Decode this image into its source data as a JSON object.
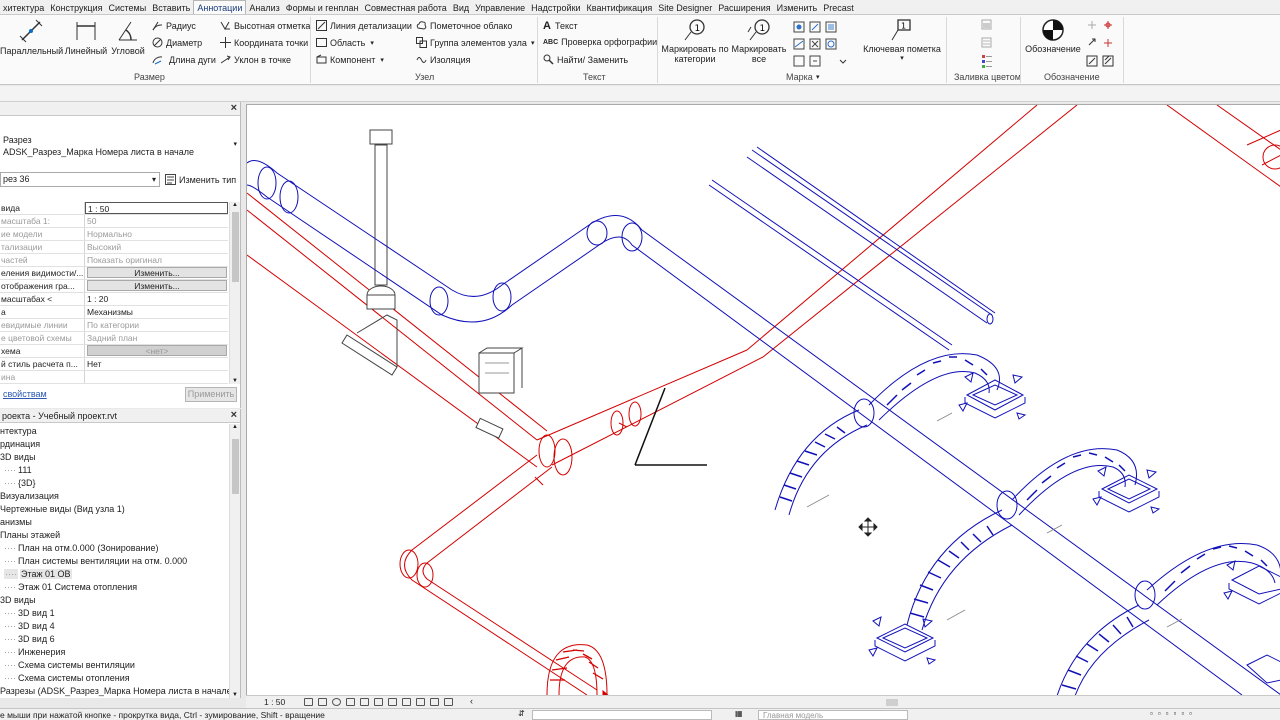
{
  "tabs": [
    {
      "label": "хитектура",
      "active": false
    },
    {
      "label": "Конструкция",
      "active": false
    },
    {
      "label": "Системы",
      "active": false
    },
    {
      "label": "Вставить",
      "active": false
    },
    {
      "label": "Аннотации",
      "active": true
    },
    {
      "label": "Анализ",
      "active": false
    },
    {
      "label": "Формы и генплан",
      "active": false
    },
    {
      "label": "Совместная работа",
      "active": false
    },
    {
      "label": "Вид",
      "active": false
    },
    {
      "label": "Управление",
      "active": false
    },
    {
      "label": "Надстройки",
      "active": false
    },
    {
      "label": "Квантификация",
      "active": false
    },
    {
      "label": "Site Designer",
      "active": false
    },
    {
      "label": "Расширения",
      "active": false
    },
    {
      "label": "Изменить",
      "active": false
    },
    {
      "label": "Precast",
      "active": false
    }
  ],
  "ribbon": {
    "dimension": {
      "parallel": "Параллельный",
      "linear": "Линейный",
      "angular": "Угловой",
      "radius": "Радиус",
      "diameter": "Диаметр",
      "arc_length": "Длина дуги",
      "spot_elevation": "Высотная отметка",
      "spot_coordinate": "Координата точки",
      "spot_slope": "Уклон  в точке",
      "panel": "Размер"
    },
    "detail": {
      "detail_line": "Линия детализации",
      "region": "Область",
      "component": "Компонент",
      "revision_cloud": "Пометочное облако",
      "detail_group": "Группа элементов узла",
      "insulation": "Изоляция",
      "panel": "Узел"
    },
    "text": {
      "text": "Текст",
      "spelling": "Проверка  орфографии",
      "find_replace": "Найти/ Заменить",
      "panel": "Текст"
    },
    "tag": {
      "by_category": "Маркировать по категории",
      "tag_all": "Маркировать все",
      "keynote": "Ключевая пометка",
      "panel": "Марка"
    },
    "color_fill": {
      "panel": "Заливка цветом"
    },
    "symbol": {
      "symbol": "Обозначение",
      "panel": "Обозначение"
    }
  },
  "properties": {
    "type_family": "Разрез",
    "type_name": "ADSK_Разрез_Марка Номера листа в начале",
    "selector": "рез 36",
    "edit_type": "Изменить тип",
    "rows": [
      {
        "k": "вида",
        "v": "1 : 50",
        "dim": false,
        "boxed": true
      },
      {
        "k": "масштаба   1:",
        "v": "50",
        "dim": true
      },
      {
        "k": "ие модели",
        "v": "Нормально",
        "dim": true
      },
      {
        "k": "тализации",
        "v": "Высокий",
        "dim": true
      },
      {
        "k": "частей",
        "v": "Показать оригинал",
        "dim": true
      },
      {
        "k": "еления видимости/...",
        "v": "Изменить...",
        "btn": true
      },
      {
        "k": "отображения гра...",
        "v": "Изменить...",
        "btn": true
      },
      {
        "k": "масштабах <",
        "v": "1 : 20",
        "dim": false
      },
      {
        "k": "а",
        "v": "Механизмы",
        "dim": false
      },
      {
        "k": "евидимые линии",
        "v": "По категории",
        "dim": true
      },
      {
        "k": "е цветовой схемы",
        "v": "Задний план",
        "dim": true
      },
      {
        "k": "хема",
        "v": "<нет>",
        "btn": true,
        "disabled": true
      },
      {
        "k": "й стиль расчета п...",
        "v": "Нет",
        "dim": false
      },
      {
        "k": "ина",
        "v": "",
        "dim": true
      }
    ],
    "link": "свойствам",
    "apply": "Применить"
  },
  "browser": {
    "title": "роекта - Учебный проект.rvt",
    "items": [
      {
        "label": "нтектура",
        "indent": 0
      },
      {
        "label": "рдинация",
        "indent": 0
      },
      {
        "label": "3D виды",
        "indent": 0
      },
      {
        "label": "111",
        "indent": 1,
        "dots": true
      },
      {
        "label": "{3D}",
        "indent": 1,
        "dots": true
      },
      {
        "label": "Визуализация",
        "indent": 0
      },
      {
        "label": "Чертежные виды (Вид узла 1)",
        "indent": 0
      },
      {
        "label": "анизмы",
        "indent": 0
      },
      {
        "label": "Планы этажей",
        "indent": 0
      },
      {
        "label": "План на отм.0.000 (Зонирование)",
        "indent": 1,
        "dots": true
      },
      {
        "label": "План системы вентиляции на отм. 0.000",
        "indent": 1,
        "dots": true
      },
      {
        "label": "Этаж 01 ОВ",
        "indent": 1,
        "dots": true,
        "selected": true
      },
      {
        "label": "Этаж 01 Система отопления",
        "indent": 1,
        "dots": true
      },
      {
        "label": "3D виды",
        "indent": 0
      },
      {
        "label": "3D вид 1",
        "indent": 1,
        "dots": true
      },
      {
        "label": "3D вид 4",
        "indent": 1,
        "dots": true
      },
      {
        "label": "3D вид 6",
        "indent": 1,
        "dots": true
      },
      {
        "label": "Инженерия",
        "indent": 1,
        "dots": true
      },
      {
        "label": "Схема системы вентиляции",
        "indent": 1,
        "dots": true
      },
      {
        "label": "Схема системы отопления",
        "indent": 1,
        "dots": true
      },
      {
        "label": "Разрезы (ADSK_Разрез_Марка Номера листа в начале)",
        "indent": 0
      }
    ]
  },
  "viewbar": {
    "scale": "1 : 50"
  },
  "status": {
    "message": "е мыши при нажатой кнопке - прокрутка вида, Ctrl - зумирование, Shift - вращение",
    "model": "Главная модель"
  },
  "colors": {
    "supply": "#d40000",
    "exhaust": "#1010b8"
  }
}
